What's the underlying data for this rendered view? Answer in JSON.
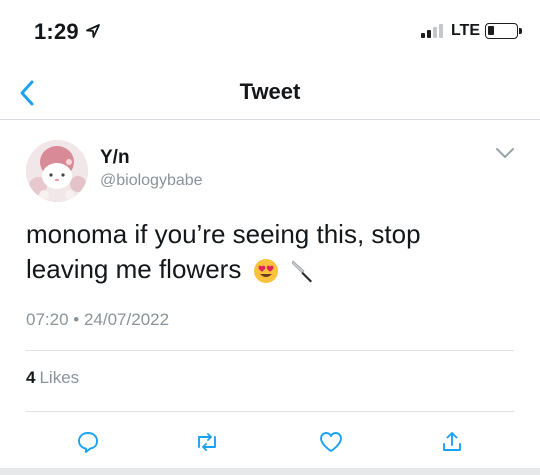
{
  "status_bar": {
    "time": "1:29",
    "network": "LTE"
  },
  "nav": {
    "title": "Tweet",
    "back_icon": "chevron-left-icon"
  },
  "tweet": {
    "author_name": "Y/n",
    "author_handle": "@biologybabe",
    "text_line1": "monoma if you’re seeing this, stop",
    "text_line2": "leaving me flowers",
    "emojis": [
      "heart-eyes-emoji",
      "knife-emoji"
    ],
    "time": "07:20",
    "separator": "•",
    "date": "24/07/2022",
    "likes_count": "4",
    "likes_label": "Likes"
  },
  "actions": [
    "reply-icon",
    "retweet-icon",
    "like-icon",
    "share-icon"
  ],
  "colors": {
    "accent": "#1da1f2",
    "text": "#14171a",
    "muted": "#8a9399",
    "divider": "#dde1e4"
  }
}
